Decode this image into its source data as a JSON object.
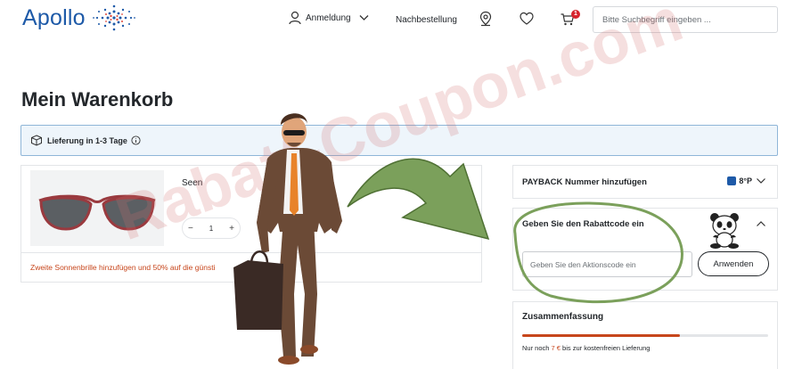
{
  "header": {
    "logo_text": "Apollo",
    "login_label": "Anmeldung",
    "reorder_label": "Nachbestellung",
    "cart_count": "1",
    "search_placeholder": "Bitte Suchbegriff eingeben ..."
  },
  "page": {
    "title": "Mein Warenkorb",
    "delivery_text": "Lieferung in 1-3 Tage"
  },
  "cart": {
    "items": [
      {
        "name": "Seen",
        "quantity": "1",
        "qty_minus": "−",
        "qty_plus": "+"
      }
    ],
    "promo_text": "Zweite Sonnenbrille hinzufügen und 50% auf die günsti"
  },
  "sidebar": {
    "payback_label": "PAYBACK Nummer hinzufügen",
    "payback_points": "8°P",
    "coupon_label": "Geben Sie den Rabattcode ein",
    "coupon_placeholder": "Geben Sie den Aktionscode ein",
    "apply_label": "Anwenden",
    "summary_label": "Zusammenfassung",
    "free_shipping_progress": 0.64,
    "shipping_note_prefix": "Nur noch ",
    "shipping_note_amount": "7 €",
    "shipping_note_suffix": " bis zur kostenfreien Lieferung"
  },
  "overlay": {
    "watermark_text": "Rabatt-Coupon.com"
  },
  "colors": {
    "brand_blue": "#1e5aa8",
    "accent_orange": "#c7461c",
    "badge_red": "#d6232d",
    "delivery_bg": "#eef5fb",
    "arrow_green": "#7ba05b"
  },
  "icons": [
    "user-icon",
    "chevron-down-icon",
    "location-pin-icon",
    "heart-icon",
    "cart-icon",
    "package-icon",
    "info-icon",
    "payback-icon",
    "chevron-up-icon",
    "panda-icon"
  ]
}
